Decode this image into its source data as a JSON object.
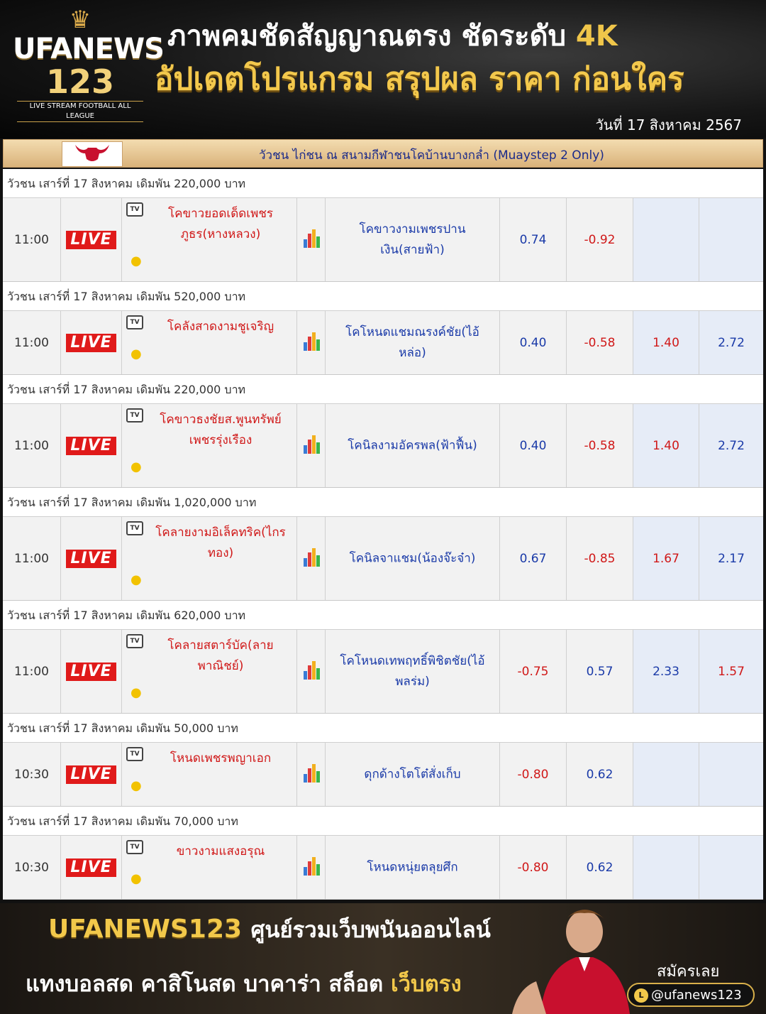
{
  "header": {
    "logo": {
      "brand": "UFANEWS",
      "number": "123",
      "tagline": "LIVE STREAM FOOTBALL ALL LEAGUE"
    },
    "headline_1": "ภาพคมชัดสัญญาณตรง ชัดระดับ ",
    "headline_1_highlight": "4K",
    "headline_2": "อัปเดตโปรแกรม สรุปผล ราคา ก่อนใคร",
    "date": "วันที่ 17 สิงหาคม 2567"
  },
  "league": {
    "name": "วัวชน ไก่ชน ณ สนามกีฬาชนโคบ้านบางกล่ำ (Muaystep 2 Only)",
    "icon": "bull-icon"
  },
  "live_label": "LIVE",
  "tv_label": "TV",
  "matches": [
    {
      "group": "วัวชน เสาร์ที่ 17 สิงหาคม เดิมพัน 220,000 บาท",
      "time": "11:00",
      "home": "โคขาวยอดเด็ดเพชรภูธร(หางหลวง)",
      "away": "โคขาวงามเพชรปานเงิน(สายฟ้า)",
      "o1": "0.74",
      "o2": "-0.92",
      "o3": "",
      "o4": ""
    },
    {
      "group": "วัวชน เสาร์ที่ 17 สิงหาคม เดิมพัน 520,000 บาท",
      "time": "11:00",
      "home": "โคลังสาดงามชูเจริญ",
      "away": "โคโหนดแชมณรงค์ชัย(ไอ้หล่อ)",
      "o1": "0.40",
      "o2": "-0.58",
      "o3": "1.40",
      "o4": "2.72"
    },
    {
      "group": "วัวชน เสาร์ที่ 17 สิงหาคม เดิมพัน 220,000 บาท",
      "time": "11:00",
      "home": "โคขาวธงชัยส.พูนทรัพย์เพชรรุ่งเรือง",
      "away": "โคนิลงามอัครพล(ฟ้าฟื้น)",
      "o1": "0.40",
      "o2": "-0.58",
      "o3": "1.40",
      "o4": "2.72"
    },
    {
      "group": "วัวชน เสาร์ที่ 17 สิงหาคม เดิมพัน 1,020,000 บาท",
      "time": "11:00",
      "home": "โคลายงามอิเล็คทริค(ไกรทอง)",
      "away": "โคนิลจาแชม(น้องจ๊ะจ๋า)",
      "o1": "0.67",
      "o2": "-0.85",
      "o3": "1.67",
      "o4": "2.17"
    },
    {
      "group": "วัวชน เสาร์ที่ 17 สิงหาคม เดิมพัน 620,000 บาท",
      "time": "11:00",
      "home": "โคลายสตาร์บัค(ลายพาณิชย์)",
      "away": "โคโหนดเทพฤทธิ์พิชิตชัย(ไอ้พลร่ม)",
      "o1": "-0.75",
      "o2": "0.57",
      "o3": "2.33",
      "o4": "1.57"
    },
    {
      "group": "วัวชน เสาร์ที่ 17 สิงหาคม เดิมพัน 50,000 บาท",
      "time": "10:30",
      "home": "โหนดเพชรพญาเอก",
      "away": "ดุกด้างโตโต๋สั่งเก็บ",
      "o1": "-0.80",
      "o2": "0.62",
      "o3": "",
      "o4": ""
    },
    {
      "group": "วัวชน เสาร์ที่ 17 สิงหาคม เดิมพัน 70,000 บาท",
      "time": "10:30",
      "home": "ขาวงามแสงอรุณ",
      "away": "โหนดหนุ่ยตลุยศึก",
      "o1": "-0.80",
      "o2": "0.62",
      "o3": "",
      "o4": ""
    }
  ],
  "footer": {
    "brand": "UFANEWS123",
    "slogan": "ศูนย์รวมเว็บพนันออนไลน์",
    "line2": "แทงบอลสด คาสิโนสด บาคาร่า สล็อต ",
    "line2_highlight": "เว็บตรง",
    "signup": "สมัครเลย",
    "line_id": "@ufanews123"
  },
  "colors": {
    "home_team": "#d01818",
    "away_team": "#1a3aa8",
    "live_badge": "#e01a1a",
    "gold": "#f2c84a"
  }
}
